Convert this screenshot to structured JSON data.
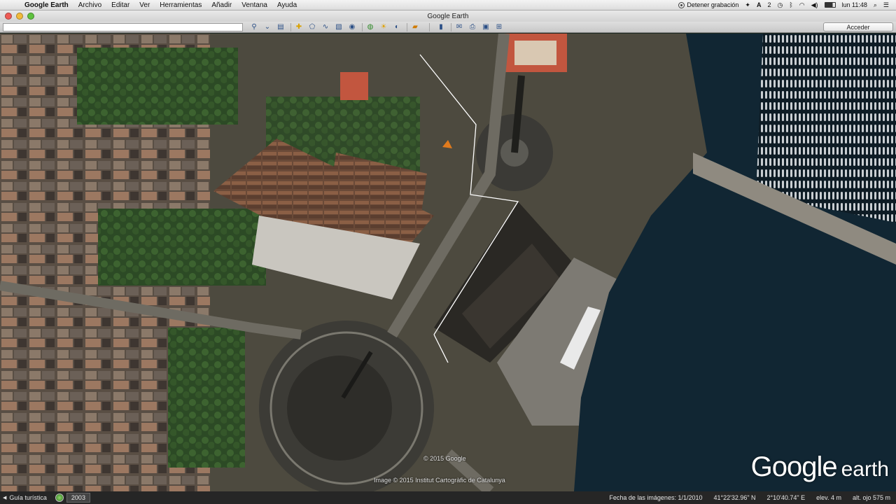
{
  "menubar": {
    "items": [
      "Google Earth",
      "Archivo",
      "Editar",
      "Ver",
      "Herramientas",
      "Añadir",
      "Ventana",
      "Ayuda"
    ],
    "recording_label": "Detener grabación",
    "badge_count": "2",
    "clock": "lun 11:48"
  },
  "window": {
    "title": "Google Earth"
  },
  "toolbar": {
    "search_value": "",
    "signin_label": "Acceder"
  },
  "map": {
    "copyright_google": "© 2015 Google",
    "copyright_image": "Image © 2015 Institut Cartogràfic de Catalunya",
    "logo_google": "Google",
    "logo_earth": "earth"
  },
  "statusbar": {
    "tour_label": "Guía turística",
    "year": "2003",
    "imagery_date": "Fecha de las imágenes: 1/1/2010",
    "lat": "41°22'32.96\" N",
    "lon": "2°10'40.74\" E",
    "elevation": "elev.    4 m",
    "eye_alt": "alt. ojo    575 m"
  }
}
